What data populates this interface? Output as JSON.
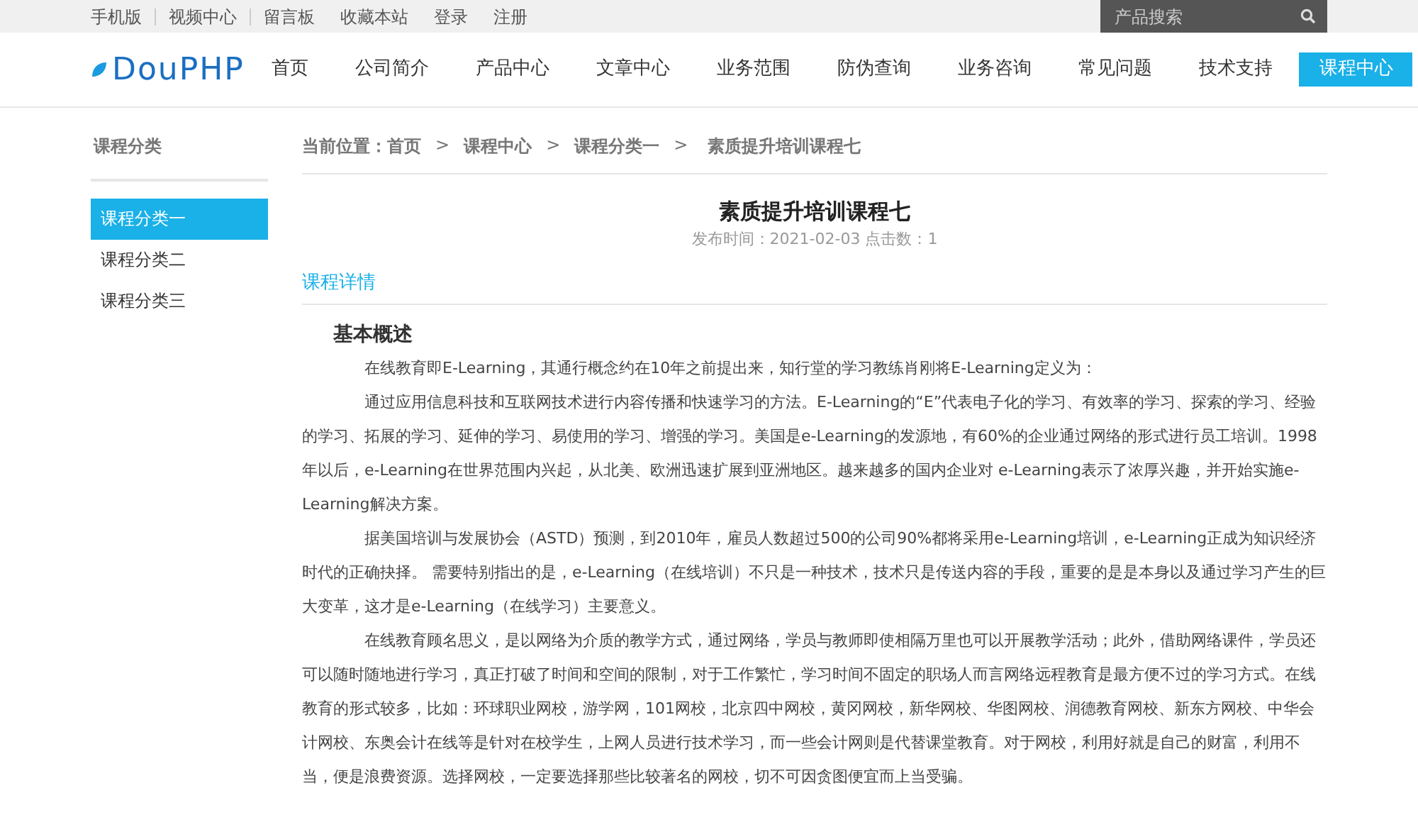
{
  "top_links": [
    {
      "label": "手机版",
      "divider": true
    },
    {
      "label": "视频中心",
      "divider": true
    },
    {
      "label": "留言板",
      "divider": false
    },
    {
      "label": "收藏本站",
      "divider": false
    },
    {
      "label": "登录",
      "divider": false
    },
    {
      "label": "注册",
      "divider": false
    }
  ],
  "search": {
    "placeholder": "产品搜索"
  },
  "logo": {
    "text": "DouPHP"
  },
  "nav": [
    {
      "label": "首页",
      "selected": false
    },
    {
      "label": "公司简介",
      "selected": false
    },
    {
      "label": "产品中心",
      "selected": false
    },
    {
      "label": "文章中心",
      "selected": false
    },
    {
      "label": "业务范围",
      "selected": false
    },
    {
      "label": "防伪查询",
      "selected": false
    },
    {
      "label": "业务咨询",
      "selected": false
    },
    {
      "label": "常见问题",
      "selected": false
    },
    {
      "label": "技术支持",
      "selected": false
    },
    {
      "label": "课程中心",
      "selected": true
    }
  ],
  "sidebar": {
    "title": "课程分类",
    "items": [
      {
        "label": "课程分类一",
        "selected": true
      },
      {
        "label": "课程分类二",
        "selected": false
      },
      {
        "label": "课程分类三",
        "selected": false
      }
    ]
  },
  "breadcrumb": {
    "label": "当前位置：",
    "items": [
      {
        "kind": "link",
        "text": "首页"
      },
      {
        "kind": "separator",
        "text": ">"
      },
      {
        "kind": "link",
        "text": "课程中心"
      },
      {
        "kind": "separator",
        "text": ">"
      },
      {
        "kind": "link",
        "text": "课程分类一"
      },
      {
        "kind": "separator",
        "text": ">"
      },
      {
        "kind": "current",
        "text": "素质提升培训课程七"
      }
    ]
  },
  "article": {
    "title": "素质提升培训课程七",
    "meta": "发布时间：2021-02-03 点击数：1",
    "section_tab": "课程详情",
    "heading": "基本概述",
    "paragraphs": [
      "在线教育即E-Learning，其通行概念约在10年之前提出来，知行堂的学习教练肖刚将E-Learning定义为：",
      "通过应用信息科技和互联网技术进行内容传播和快速学习的方法。E-Learning的“E”代表电子化的学习、有效率的学习、探索的学习、经验的学习、拓展的学习、延伸的学习、易使用的学习、增强的学习。美国是e-Learning的发源地，有60%的企业通过网络的形式进行员工培训。1998年以后，e-Learning在世界范围内兴起，从北美、欧洲迅速扩展到亚洲地区。越来越多的国内企业对 e-Learning表示了浓厚兴趣，并开始实施e-Learning解决方案。",
      "据美国培训与发展协会（ASTD）预测，到2010年，雇员人数超过500的公司90%都将采用e-Learning培训，e-Learning正成为知识经济时代的正确抉择。 需要特别指出的是，e-Learning（在线培训）不只是一种技术，技术只是传送内容的手段，重要的是是本身以及通过学习产生的巨大变革，这才是e-Learning（在线学习）主要意义。",
      "在线教育顾名思义，是以网络为介质的教学方式，通过网络，学员与教师即使相隔万里也可以开展教学活动；此外，借助网络课件，学员还可以随时随地进行学习，真正打破了时间和空间的限制，对于工作繁忙，学习时间不固定的职场人而言网络远程教育是最方便不过的学习方式。在线教育的形式较多，比如：环球职业网校，游学网，101网校，北京四中网校，黄冈网校，新华网校、华图网校、润德教育网校、新东方网校、中华会计网校、东奥会计在线等是针对在校学生，上网人员进行技术学习，而一些会计网则是代替课堂教育。对于网校，利用好就是自己的财富，利用不当，便是浪费资源。选择网校，一定要选择那些比较著名的网校，切不可因贪图便宜而上当受骗。"
    ]
  }
}
